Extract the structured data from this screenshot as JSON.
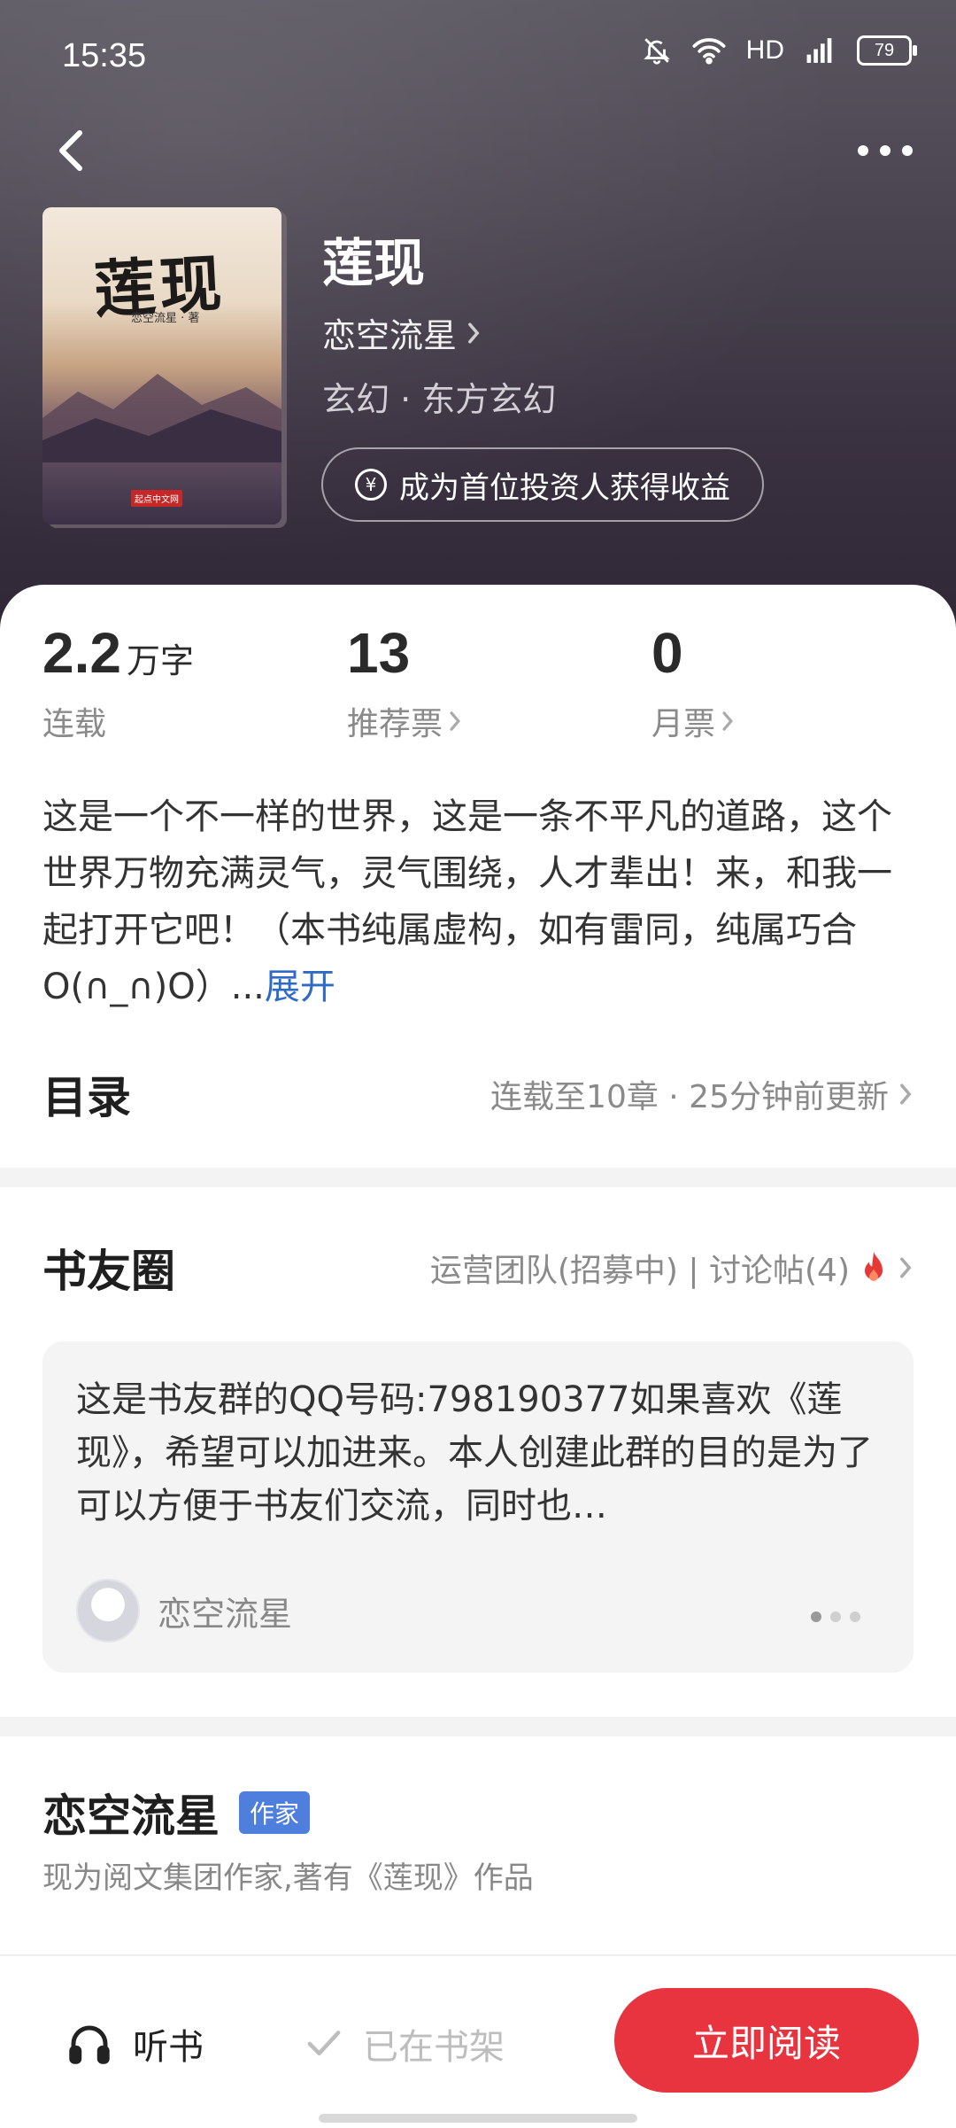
{
  "status_bar": {
    "time": "15:35",
    "network": "HD",
    "battery": "79"
  },
  "book": {
    "title": "莲现",
    "author": "恋空流星",
    "genre": "玄幻 · 东方玄幻",
    "cover_title": "莲现",
    "cover_author": "恋空流星 · 著",
    "cover_publisher": "起点中文网",
    "invest_label": "成为首位投资人获得收益",
    "coin_symbol": "¥"
  },
  "stats": [
    {
      "value": "2.2",
      "unit": "万字",
      "label": "连载"
    },
    {
      "value": "13",
      "unit": "",
      "label": "推荐票"
    },
    {
      "value": "0",
      "unit": "",
      "label": "月票"
    }
  ],
  "intro": {
    "text": "这是一个不一样的世界，这是一条不平凡的道路，这个世界万物充满灵气，灵气围绕，人才辈出！来，和我一起打开它吧！（本书纯属虚构，如有雷同，纯属巧合O(∩_∩)O）...",
    "expand": "展开"
  },
  "catalog": {
    "title": "目录",
    "meta": "连载至10章 · 25分钟前更新"
  },
  "community": {
    "title": "书友圈",
    "meta": "运营团队(招募中) | 讨论帖(4)",
    "post_text": "这是书友群的QQ号码:798190377如果喜欢《莲现》，希望可以加进来。本人创建此群的目的是为了可以方便于书友们交流，同时也…",
    "post_user": "恋空流星"
  },
  "author_section": {
    "name": "恋空流星",
    "badge": "作家",
    "desc": "现为阅文集团作家,著有《莲现》作品"
  },
  "bottom_bar": {
    "listen": "听书",
    "shelf": "已在书架",
    "read": "立即阅读"
  },
  "colors": {
    "accent": "#e8343f",
    "link": "#2f6bc6",
    "badge": "#4f7fdc"
  }
}
